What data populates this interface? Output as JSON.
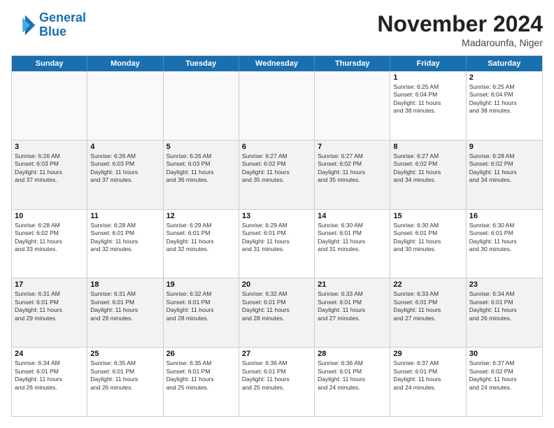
{
  "logo": {
    "text_line1": "General",
    "text_line2": "Blue"
  },
  "title": "November 2024",
  "location": "Madarounfa, Niger",
  "header_days": [
    "Sunday",
    "Monday",
    "Tuesday",
    "Wednesday",
    "Thursday",
    "Friday",
    "Saturday"
  ],
  "rows": [
    {
      "cells": [
        {
          "day": "",
          "info": "",
          "empty": true
        },
        {
          "day": "",
          "info": "",
          "empty": true
        },
        {
          "day": "",
          "info": "",
          "empty": true
        },
        {
          "day": "",
          "info": "",
          "empty": true
        },
        {
          "day": "",
          "info": "",
          "empty": true
        },
        {
          "day": "1",
          "info": "Sunrise: 6:25 AM\nSunset: 6:04 PM\nDaylight: 11 hours\nand 38 minutes."
        },
        {
          "day": "2",
          "info": "Sunrise: 6:25 AM\nSunset: 6:04 PM\nDaylight: 11 hours\nand 38 minutes."
        }
      ]
    },
    {
      "alt": true,
      "cells": [
        {
          "day": "3",
          "info": "Sunrise: 6:26 AM\nSunset: 6:03 PM\nDaylight: 11 hours\nand 37 minutes."
        },
        {
          "day": "4",
          "info": "Sunrise: 6:26 AM\nSunset: 6:03 PM\nDaylight: 11 hours\nand 37 minutes."
        },
        {
          "day": "5",
          "info": "Sunrise: 6:26 AM\nSunset: 6:03 PM\nDaylight: 11 hours\nand 36 minutes."
        },
        {
          "day": "6",
          "info": "Sunrise: 6:27 AM\nSunset: 6:02 PM\nDaylight: 11 hours\nand 35 minutes."
        },
        {
          "day": "7",
          "info": "Sunrise: 6:27 AM\nSunset: 6:02 PM\nDaylight: 11 hours\nand 35 minutes."
        },
        {
          "day": "8",
          "info": "Sunrise: 6:27 AM\nSunset: 6:02 PM\nDaylight: 11 hours\nand 34 minutes."
        },
        {
          "day": "9",
          "info": "Sunrise: 6:28 AM\nSunset: 6:02 PM\nDaylight: 11 hours\nand 34 minutes."
        }
      ]
    },
    {
      "cells": [
        {
          "day": "10",
          "info": "Sunrise: 6:28 AM\nSunset: 6:02 PM\nDaylight: 11 hours\nand 33 minutes."
        },
        {
          "day": "11",
          "info": "Sunrise: 6:28 AM\nSunset: 6:01 PM\nDaylight: 11 hours\nand 32 minutes."
        },
        {
          "day": "12",
          "info": "Sunrise: 6:29 AM\nSunset: 6:01 PM\nDaylight: 11 hours\nand 32 minutes."
        },
        {
          "day": "13",
          "info": "Sunrise: 6:29 AM\nSunset: 6:01 PM\nDaylight: 11 hours\nand 31 minutes."
        },
        {
          "day": "14",
          "info": "Sunrise: 6:30 AM\nSunset: 6:01 PM\nDaylight: 11 hours\nand 31 minutes."
        },
        {
          "day": "15",
          "info": "Sunrise: 6:30 AM\nSunset: 6:01 PM\nDaylight: 11 hours\nand 30 minutes."
        },
        {
          "day": "16",
          "info": "Sunrise: 6:30 AM\nSunset: 6:01 PM\nDaylight: 11 hours\nand 30 minutes."
        }
      ]
    },
    {
      "alt": true,
      "cells": [
        {
          "day": "17",
          "info": "Sunrise: 6:31 AM\nSunset: 6:01 PM\nDaylight: 11 hours\nand 29 minutes."
        },
        {
          "day": "18",
          "info": "Sunrise: 6:31 AM\nSunset: 6:01 PM\nDaylight: 11 hours\nand 29 minutes."
        },
        {
          "day": "19",
          "info": "Sunrise: 6:32 AM\nSunset: 6:01 PM\nDaylight: 11 hours\nand 28 minutes."
        },
        {
          "day": "20",
          "info": "Sunrise: 6:32 AM\nSunset: 6:01 PM\nDaylight: 11 hours\nand 28 minutes."
        },
        {
          "day": "21",
          "info": "Sunrise: 6:33 AM\nSunset: 6:01 PM\nDaylight: 11 hours\nand 27 minutes."
        },
        {
          "day": "22",
          "info": "Sunrise: 6:33 AM\nSunset: 6:01 PM\nDaylight: 11 hours\nand 27 minutes."
        },
        {
          "day": "23",
          "info": "Sunrise: 6:34 AM\nSunset: 6:01 PM\nDaylight: 11 hours\nand 26 minutes."
        }
      ]
    },
    {
      "cells": [
        {
          "day": "24",
          "info": "Sunrise: 6:34 AM\nSunset: 6:01 PM\nDaylight: 11 hours\nand 26 minutes."
        },
        {
          "day": "25",
          "info": "Sunrise: 6:35 AM\nSunset: 6:01 PM\nDaylight: 11 hours\nand 26 minutes."
        },
        {
          "day": "26",
          "info": "Sunrise: 6:35 AM\nSunset: 6:01 PM\nDaylight: 11 hours\nand 25 minutes."
        },
        {
          "day": "27",
          "info": "Sunrise: 6:36 AM\nSunset: 6:01 PM\nDaylight: 11 hours\nand 25 minutes."
        },
        {
          "day": "28",
          "info": "Sunrise: 6:36 AM\nSunset: 6:01 PM\nDaylight: 11 hours\nand 24 minutes."
        },
        {
          "day": "29",
          "info": "Sunrise: 6:37 AM\nSunset: 6:01 PM\nDaylight: 11 hours\nand 24 minutes."
        },
        {
          "day": "30",
          "info": "Sunrise: 6:37 AM\nSunset: 6:02 PM\nDaylight: 11 hours\nand 24 minutes."
        }
      ]
    }
  ]
}
